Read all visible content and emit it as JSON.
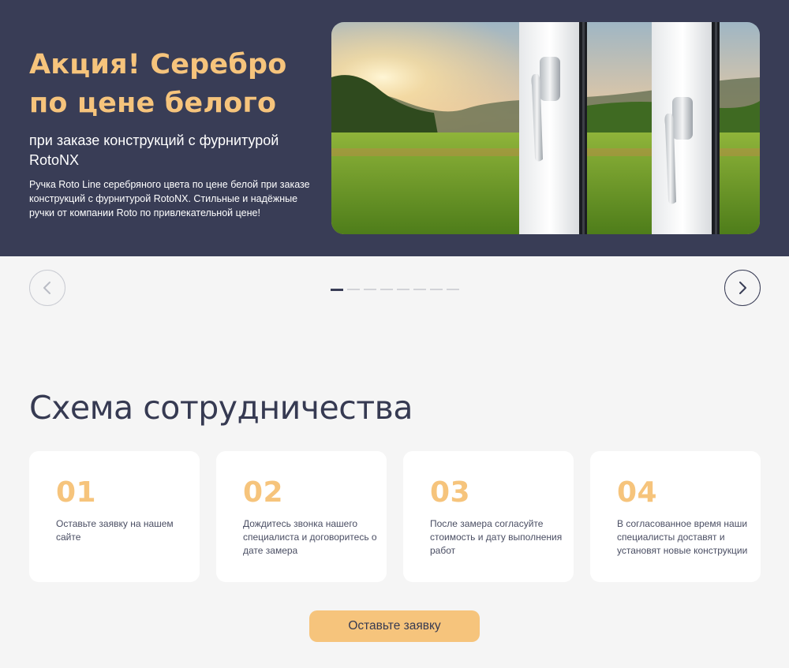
{
  "hero": {
    "title": "Акция! Серебро по цене белого",
    "subtitle": "при заказе конструкций с фурнитурой RotoNX",
    "description": "Ручка Roto Line серебряного цвета по цене белой при заказе конструкций с фурнитурой RotoNX. Стильные и надёжные ручки от компании Roto по привлекательной цене!",
    "image": "window-handles-landscape-photo"
  },
  "slider": {
    "prev_icon": "chevron-left-icon",
    "next_icon": "chevron-right-icon",
    "slide_count": 8,
    "active_slide": 1
  },
  "section": {
    "title": "Схема сотрудничества"
  },
  "steps": [
    {
      "number": "01",
      "text": "Оставьте заявку на нашем сайте"
    },
    {
      "number": "02",
      "text": "Дождитесь звонка нашего специалиста и договоритесь о дате замера"
    },
    {
      "number": "03",
      "text": "После замера согласуйте стоимость и дату выполнения работ"
    },
    {
      "number": "04",
      "text": "В согласованное время наши специалисты доставят и установят новые конструкции"
    }
  ],
  "cta": {
    "label": "Оставьте заявку"
  },
  "colors": {
    "hero_bg": "#393d56",
    "accent": "#f6c47c",
    "page_bg": "#f5f5f5",
    "text_dark": "#363a52"
  }
}
